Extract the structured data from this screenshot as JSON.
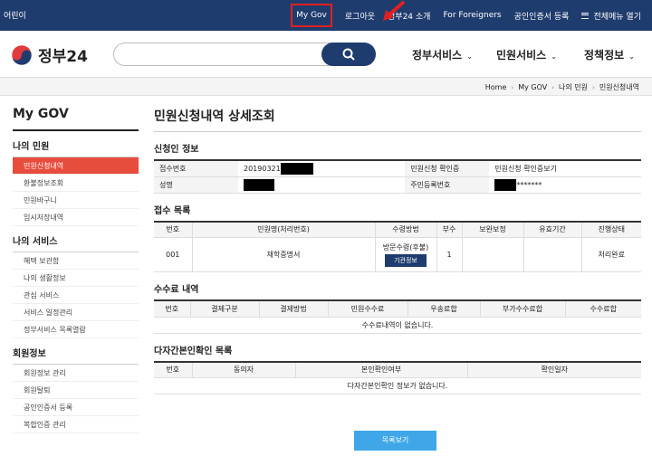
{
  "topbar": {
    "kids": "어린이",
    "links": [
      "My Gov",
      "로그아웃",
      "정부24 소개",
      "For Foreigners",
      "공인인증서 등록"
    ],
    "all_menu": "전체메뉴 열기"
  },
  "header": {
    "logo": "정부24",
    "search_placeholder": "",
    "gnb": [
      "정부서비스",
      "민원서비스",
      "정책정보"
    ]
  },
  "breadcrumb": [
    "Home",
    "My GOV",
    "나의 민원",
    "민원신청내역"
  ],
  "sidebar": {
    "title": "My GOV",
    "groups": [
      {
        "title": "나의 민원",
        "items": [
          "민원신청내역",
          "환불정보조회",
          "민원바구니",
          "임시저장내역"
        ]
      },
      {
        "title": "나의 서비스",
        "items": [
          "혜택 보관함",
          "나의 생활정보",
          "관심 서비스",
          "서비스 일정관리",
          "정부서비스 목록열람"
        ]
      },
      {
        "title": "회원정보",
        "items": [
          "회원정보 관리",
          "회원탈퇴",
          "공인인증서 등록",
          "복합인증 관리"
        ]
      }
    ]
  },
  "page_title": "민원신청내역 상세조회",
  "applicant": {
    "title": "신청인 정보",
    "receipt_no_label": "접수번호",
    "receipt_no_value": "20190321",
    "confirm_label": "민원신청 확인증",
    "confirm_value": "민원신청 확인증보기",
    "name_label": "성명",
    "rrn_label": "주민등록번호",
    "rrn_suffix": "*******"
  },
  "receipts": {
    "title": "접수 목록",
    "headers": [
      "번호",
      "민원명(처리번호)",
      "수령방법",
      "부수",
      "보완보정",
      "유효기간",
      "진행상태"
    ],
    "row": {
      "no": "001",
      "name": "재학증명서",
      "method": "방문수령(후불)",
      "org_btn": "기관정보",
      "copies": "1",
      "supplement": "",
      "validity": "",
      "status": "처리완료"
    }
  },
  "fees": {
    "title": "수수료 내역",
    "headers": [
      "번호",
      "결제구분",
      "결제방법",
      "민원수수료",
      "우송료합",
      "부가수수료합",
      "수수료합"
    ],
    "empty": "수수료내역이 없습니다."
  },
  "identity": {
    "title": "다자간본인확인 목록",
    "headers": [
      "번호",
      "동의자",
      "본인확인여부",
      "확인일자"
    ],
    "empty": "다자간본인확인 정보가 없습니다."
  },
  "list_button": "목록보기",
  "colors": {
    "navy": "#1f3c6e",
    "active": "#e74c3c",
    "button": "#3fa7e8",
    "highlight": "#e02020"
  }
}
